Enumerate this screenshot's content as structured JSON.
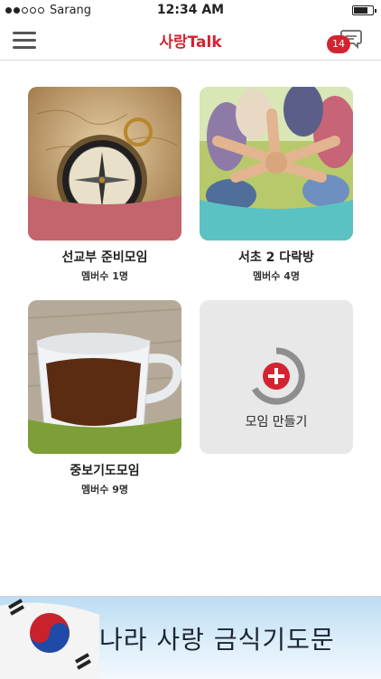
{
  "status_bar": {
    "carrier": "Sarang",
    "time": "12:34 AM"
  },
  "nav": {
    "logo": "사랑Talk",
    "chat_badge_count": "14"
  },
  "groups": [
    {
      "title": "선교부 준비모임",
      "members": "멤버수 1명",
      "icon": "compass-photo"
    },
    {
      "title": "서초 2 다락방",
      "members": "멤버수 4명",
      "icon": "hands-together-photo"
    },
    {
      "title": "중보기도모임",
      "members": "멤버수 9명",
      "icon": "tea-cup-photo"
    }
  ],
  "create_group": {
    "label": "모임 만들기",
    "icon": "plus-circle-icon"
  },
  "banner": {
    "text": "나라 사랑 금식기도문",
    "icon": "korean-flag"
  },
  "colors": {
    "accent": "#d32330",
    "card1_wave": "#c4646c",
    "card2_wave": "#5bc2c4",
    "card3_wave": "#7e9f37"
  }
}
